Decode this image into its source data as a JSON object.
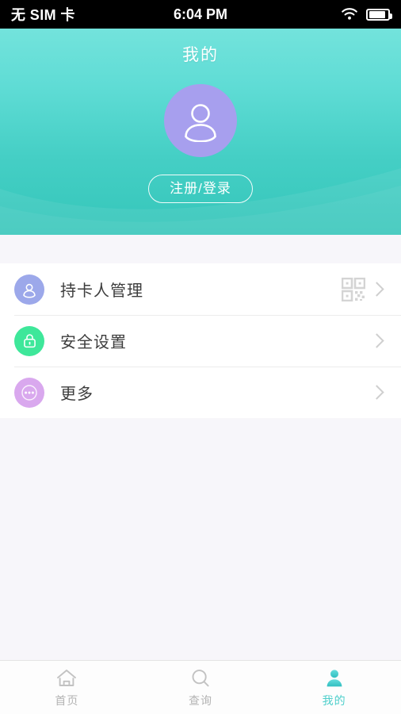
{
  "status_bar": {
    "carrier": "无 SIM 卡",
    "time": "6:04 PM",
    "wifi_icon": "wifi-icon",
    "battery_icon": "battery-icon"
  },
  "header": {
    "title": "我的",
    "avatar_icon": "user-avatar-icon",
    "avatar_color": "#a79fee",
    "login_button": "注册/登录",
    "gradient_top": "#73e3dc",
    "gradient_bottom": "#35c6ba"
  },
  "menu": {
    "items": [
      {
        "label": "持卡人管理",
        "icon": "user-icon",
        "icon_color": "#9ca8ea",
        "trailing_icon": "qr-code-icon",
        "chevron": "chevron-right-icon"
      },
      {
        "label": "安全设置",
        "icon": "lock-icon",
        "icon_color": "#3ee79a",
        "trailing_icon": "",
        "chevron": "chevron-right-icon"
      },
      {
        "label": "更多",
        "icon": "ellipsis-icon",
        "icon_color": "#d9a8ee",
        "trailing_icon": "",
        "chevron": "chevron-right-icon"
      }
    ]
  },
  "tab_bar": {
    "active_color": "#4ecfcb",
    "inactive_color": "#b4b4b4",
    "tabs": [
      {
        "label": "首页",
        "icon": "home-icon",
        "active": false
      },
      {
        "label": "查询",
        "icon": "search-icon",
        "active": false
      },
      {
        "label": "我的",
        "icon": "person-filled-icon",
        "active": true
      }
    ]
  }
}
